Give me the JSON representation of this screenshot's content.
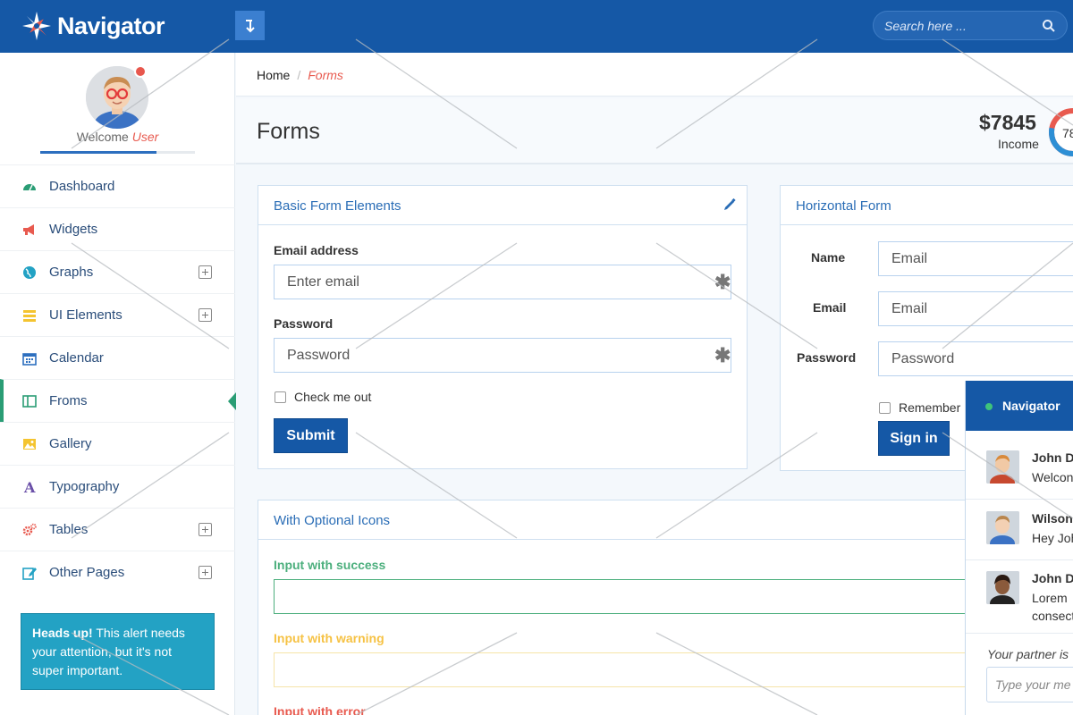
{
  "brand": {
    "name": "Navigator"
  },
  "header": {
    "search_placeholder": "Search here ..."
  },
  "profile": {
    "welcome": "Welcome",
    "user": "User",
    "progress": 0.75
  },
  "sidebar": {
    "items": [
      {
        "label": "Dashboard",
        "icon": "dashboard-icon",
        "color": "#2a9d75",
        "expandable": false
      },
      {
        "label": "Widgets",
        "icon": "megaphone-icon",
        "color": "#e85a4f",
        "expandable": false
      },
      {
        "label": "Graphs",
        "icon": "globe-icon",
        "color": "#23a2c4",
        "expandable": true
      },
      {
        "label": "UI Elements",
        "icon": "layers-icon",
        "color": "#f4c430",
        "expandable": true
      },
      {
        "label": "Calendar",
        "icon": "calendar-icon",
        "color": "#2d6fbf",
        "expandable": false
      },
      {
        "label": "Froms",
        "icon": "columns-icon",
        "color": "#2a9d75",
        "expandable": false,
        "active": true
      },
      {
        "label": "Gallery",
        "icon": "image-icon",
        "color": "#f4c430",
        "expandable": false
      },
      {
        "label": "Typography",
        "icon": "font-icon",
        "color": "#6a4fa8",
        "expandable": false
      },
      {
        "label": "Tables",
        "icon": "gears-icon",
        "color": "#e85a4f",
        "expandable": true
      },
      {
        "label": "Other Pages",
        "icon": "edit-icon",
        "color": "#23a2c4",
        "expandable": true
      }
    ],
    "alert": {
      "strong": "Heads up!",
      "text": " This alert needs your attention, but it's not super important."
    }
  },
  "breadcrumb": {
    "home": "Home",
    "sep": "/",
    "current": "Forms"
  },
  "page": {
    "title": "Forms"
  },
  "income": {
    "amount": "$7845",
    "label": "Income",
    "percent_label": "78",
    "percent": 78
  },
  "basic_form": {
    "title": "Basic Form Elements",
    "email_label": "Email address",
    "email_placeholder": "Enter email",
    "password_label": "Password",
    "password_placeholder": "Password",
    "required_mark": "✱",
    "check_label": "Check me out",
    "submit": "Submit"
  },
  "horizontal_form": {
    "title": "Horizontal Form",
    "name_label": "Name",
    "name_placeholder": "Email",
    "email_label": "Email",
    "email_placeholder": "Email",
    "password_label": "Password",
    "password_placeholder": "Password",
    "remember_label": "Remember",
    "signin": "Sign in"
  },
  "icons_form": {
    "title": "With Optional Icons",
    "success_label": "Input with success",
    "warning_label": "Input with warning",
    "error_label": "Input with error",
    "colors": {
      "success": "#4caf7d",
      "warning": "#f6c244",
      "error": "#e85a4f"
    }
  },
  "chat": {
    "title": "Navigator",
    "messages": [
      {
        "name": "John D",
        "text": "Welcon"
      },
      {
        "name": "Wilson",
        "text": "Hey Joh"
      },
      {
        "name": "John D",
        "text": "Lorem",
        "text2": "consect"
      }
    ],
    "footer": "Your partner is",
    "input_placeholder": "Type your me"
  }
}
